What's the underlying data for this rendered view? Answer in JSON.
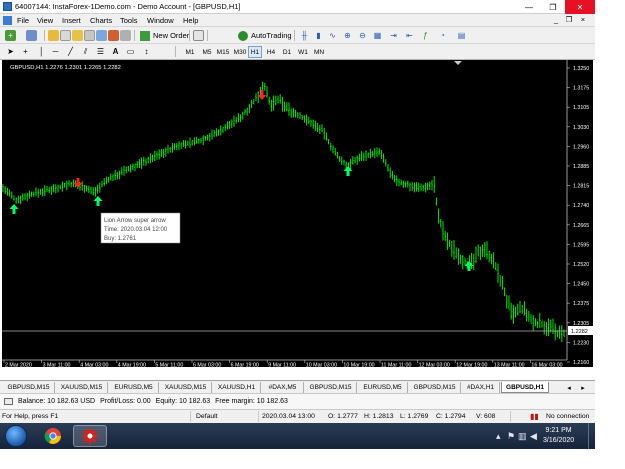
{
  "window": {
    "title": "64007144: InstaForex-1Demo.com - Demo Account - [GBPUSD,H1]",
    "minimize": "—",
    "maximize": "❐",
    "close": "✕"
  },
  "menu": {
    "items": [
      "File",
      "View",
      "Insert",
      "Charts",
      "Tools",
      "Window",
      "Help"
    ],
    "child_min": "_",
    "child_restore": "❐",
    "child_close": "×"
  },
  "toolbar": {
    "new_order": "New Order",
    "autotrading": "AutoTrading"
  },
  "timeframes": [
    "M1",
    "M5",
    "M15",
    "M30",
    "H1",
    "H4",
    "D1",
    "W1",
    "MN"
  ],
  "active_timeframe": "H1",
  "chart": {
    "header": "GBPUSD,H1  1.2276 1.2301 1.2265 1.2282",
    "current_price_label": "1.2282",
    "price_ticks": [
      "1.3250",
      "1.3175",
      "1.3105",
      "1.3030",
      "1.2960",
      "1.2885",
      "1.2815",
      "1.2740",
      "1.2665",
      "1.2595",
      "1.2520",
      "1.2450",
      "1.2375",
      "1.2305",
      "1.2230",
      "1.2160"
    ],
    "time_ticks": [
      "2 Mar 2020",
      "3 Mar 11:00",
      "4 Mar 03:00",
      "4 Mar 19:00",
      "5 Mar 11:00",
      "6 Mar 03:00",
      "6 Mar 19:00",
      "9 Mar 11:00",
      "10 Mar 03:00",
      "10 Mar 19:00",
      "11 Mar 11:00",
      "12 Mar 03:00",
      "12 Mar 19:00",
      "13 Mar 11:00",
      "16 Mar 03:00"
    ],
    "tooltip": {
      "name": "Lion Arrow super arrow",
      "time": "Time: 2020.03.04 12:00",
      "value": "Buy: 1.2761"
    },
    "colors": {
      "background": "#000000",
      "bars": "#00ff00",
      "buy_arrow": "#00ff66",
      "sell_arrow": "#ff2020",
      "price_line": "#c0c0c0"
    }
  },
  "tabs": [
    "GBPUSD,M15",
    "XAUUSD,M15",
    "EURUSD,M5",
    "XAUUSD,M15",
    "XAUUSD,H1",
    "#DAX,M5",
    "GBPUSD,M15",
    "EURUSD,M5",
    "GBPUSD,M15",
    "#DAX,H1",
    "GBPUSD,H1"
  ],
  "active_tab": "GBPUSD,H1",
  "terminal": {
    "balance": "Balance: 10 182.63 USD",
    "profit_loss": "Profit/Loss: 0.00",
    "equity": "Equity: 10 182.63",
    "free_margin": "Free margin: 10 182.63"
  },
  "status": {
    "help": "For Help, press F1",
    "profile": "Default",
    "datetime": "2020.03.04 13:00",
    "open": "O: 1.2777",
    "high": "H: 1.2813",
    "low": "L: 1.2769",
    "close": "C: 1.2794",
    "volume": "V: 608",
    "connection": "No connection"
  },
  "taskbar": {
    "time": "9:21 PM",
    "date": "3/16/2020"
  }
}
